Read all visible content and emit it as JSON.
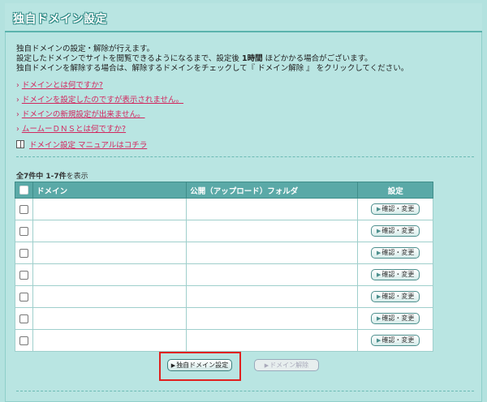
{
  "page": {
    "title": "独自ドメイン設定"
  },
  "intro": {
    "line1": "独自ドメインの設定・解除が行えます。",
    "line2_pre": "設定したドメインでサイトを閲覧できるようになるまで、設定後 ",
    "line2_bold": "1時間",
    "line2_post": " ほどかかる場合がございます。",
    "line3": "独自ドメインを解除する場合は、解除するドメインをチェックして『 ドメイン解除 』 をクリックしてください。"
  },
  "links": [
    {
      "label": "ドメインとは何ですか?"
    },
    {
      "label": "ドメインを設定したのですが表示されません。"
    },
    {
      "label": "ドメインの新規設定が出来ません。"
    },
    {
      "label": "ムームーＤＮＳとは何ですか?"
    }
  ],
  "manual": {
    "label": "ドメイン設定 マニュアルはコチラ",
    "icon": "book-icon"
  },
  "count": {
    "bold": "全7件中 1-7件",
    "suffix": "を表示"
  },
  "table": {
    "headers": {
      "domain": "ドメイン",
      "folder": "公開（アップロード）フォルダ",
      "setting": "設定"
    },
    "rows": [
      {
        "domain": "",
        "folder": "",
        "button": "確認・変更"
      },
      {
        "domain": "",
        "folder": "",
        "button": "確認・変更"
      },
      {
        "domain": "",
        "folder": "",
        "button": "確認・変更"
      },
      {
        "domain": "",
        "folder": "",
        "button": "確認・変更"
      },
      {
        "domain": "",
        "folder": "",
        "button": "確認・変更"
      },
      {
        "domain": "",
        "folder": "",
        "button": "確認・変更"
      },
      {
        "domain": "",
        "folder": "",
        "button": "確認・変更"
      }
    ]
  },
  "actions": {
    "set_label": "独自ドメイン設定",
    "release_label": "ドメイン解除"
  },
  "colors": {
    "background": "#b3e2df",
    "header": "#5aa9a7",
    "link": "#d2275e",
    "highlight": "#e0201e"
  }
}
